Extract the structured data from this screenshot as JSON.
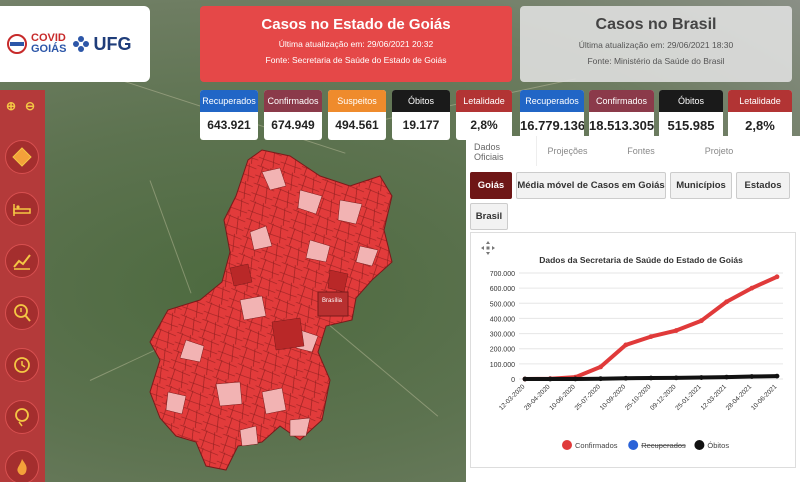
{
  "logo": {
    "covid_line1": "COVID",
    "covid_line2": "GOIÁS",
    "ufg": "UFG"
  },
  "goias_panel": {
    "title": "Casos no Estado de Goiás",
    "updated": "Última atualização em: 29/06/2021 20:32",
    "source": "Fonte: Secretaria de Saúde do Estado de Goiás"
  },
  "brasil_panel": {
    "title": "Casos no Brasil",
    "updated": "Última atualização em: 29/06/2021 18:30",
    "source": "Fonte: Ministério da Saúde do Brasil"
  },
  "goias_stats": [
    {
      "label": "Recuperados",
      "value": "643.921",
      "color": "#2166c6"
    },
    {
      "label": "Confirmados",
      "value": "674.949",
      "color": "#8b3a4a"
    },
    {
      "label": "Suspeitos",
      "value": "494.561",
      "color": "#ef8b2c"
    },
    {
      "label": "Óbitos",
      "value": "19.177",
      "color": "#1a1a1a"
    },
    {
      "label": "Letalidade",
      "value": "2,8%",
      "color": "#b23434"
    }
  ],
  "brasil_stats": [
    {
      "label": "Recuperados",
      "value": "16.779.136",
      "color": "#2166c6"
    },
    {
      "label": "Confirmados",
      "value": "18.513.305",
      "color": "#8b3a4a"
    },
    {
      "label": "Óbitos",
      "value": "515.985",
      "color": "#1a1a1a"
    },
    {
      "label": "Letalidade",
      "value": "2,8%",
      "color": "#b23434"
    }
  ],
  "subtabs": [
    {
      "label": "Dados Oficiais",
      "sub": ""
    },
    {
      "label": "",
      "sub": "Projeções"
    },
    {
      "label": "",
      "sub": "Fontes"
    },
    {
      "label": "",
      "sub": "Projeto"
    }
  ],
  "tabs": [
    "Goiás",
    "Média móvel de Casos em Goiás",
    "Municípios",
    "Estados",
    "Brasil"
  ],
  "map": {
    "city_label": "Brasília"
  },
  "chart_data": {
    "type": "line",
    "title": "Dados da Secretaria de Saúde do Estado de Goiás",
    "x": [
      "12-03-2020",
      "28-04-2020",
      "10-06-2020",
      "25-07-2020",
      "10-09-2020",
      "25-10-2020",
      "09-12-2020",
      "25-01-2021",
      "12-03-2021",
      "28-04-2021",
      "10-06-2021"
    ],
    "ylim": [
      0,
      700000
    ],
    "yticks": [
      "0",
      "100.000",
      "200.000",
      "300.000",
      "400.000",
      "500.000",
      "600.000",
      "700.000"
    ],
    "series": [
      {
        "name": "Confirmados",
        "color": "#e03a3a",
        "values": [
          0,
          2000,
          12000,
          80000,
          225000,
          280000,
          320000,
          385000,
          510000,
          600000,
          675000
        ]
      },
      {
        "name": "Recuperados",
        "color": "#2a62d8",
        "strikethrough": true,
        "values": []
      },
      {
        "name": "Óbitos",
        "color": "#111111",
        "values": [
          0,
          0,
          300,
          2000,
          5000,
          6500,
          7500,
          9500,
          12500,
          16500,
          19177
        ]
      }
    ],
    "legend_position": "bottom"
  },
  "colors": {
    "sidebar": "#b43a3a",
    "accent": "#e54848",
    "icon": "#f4c744"
  }
}
